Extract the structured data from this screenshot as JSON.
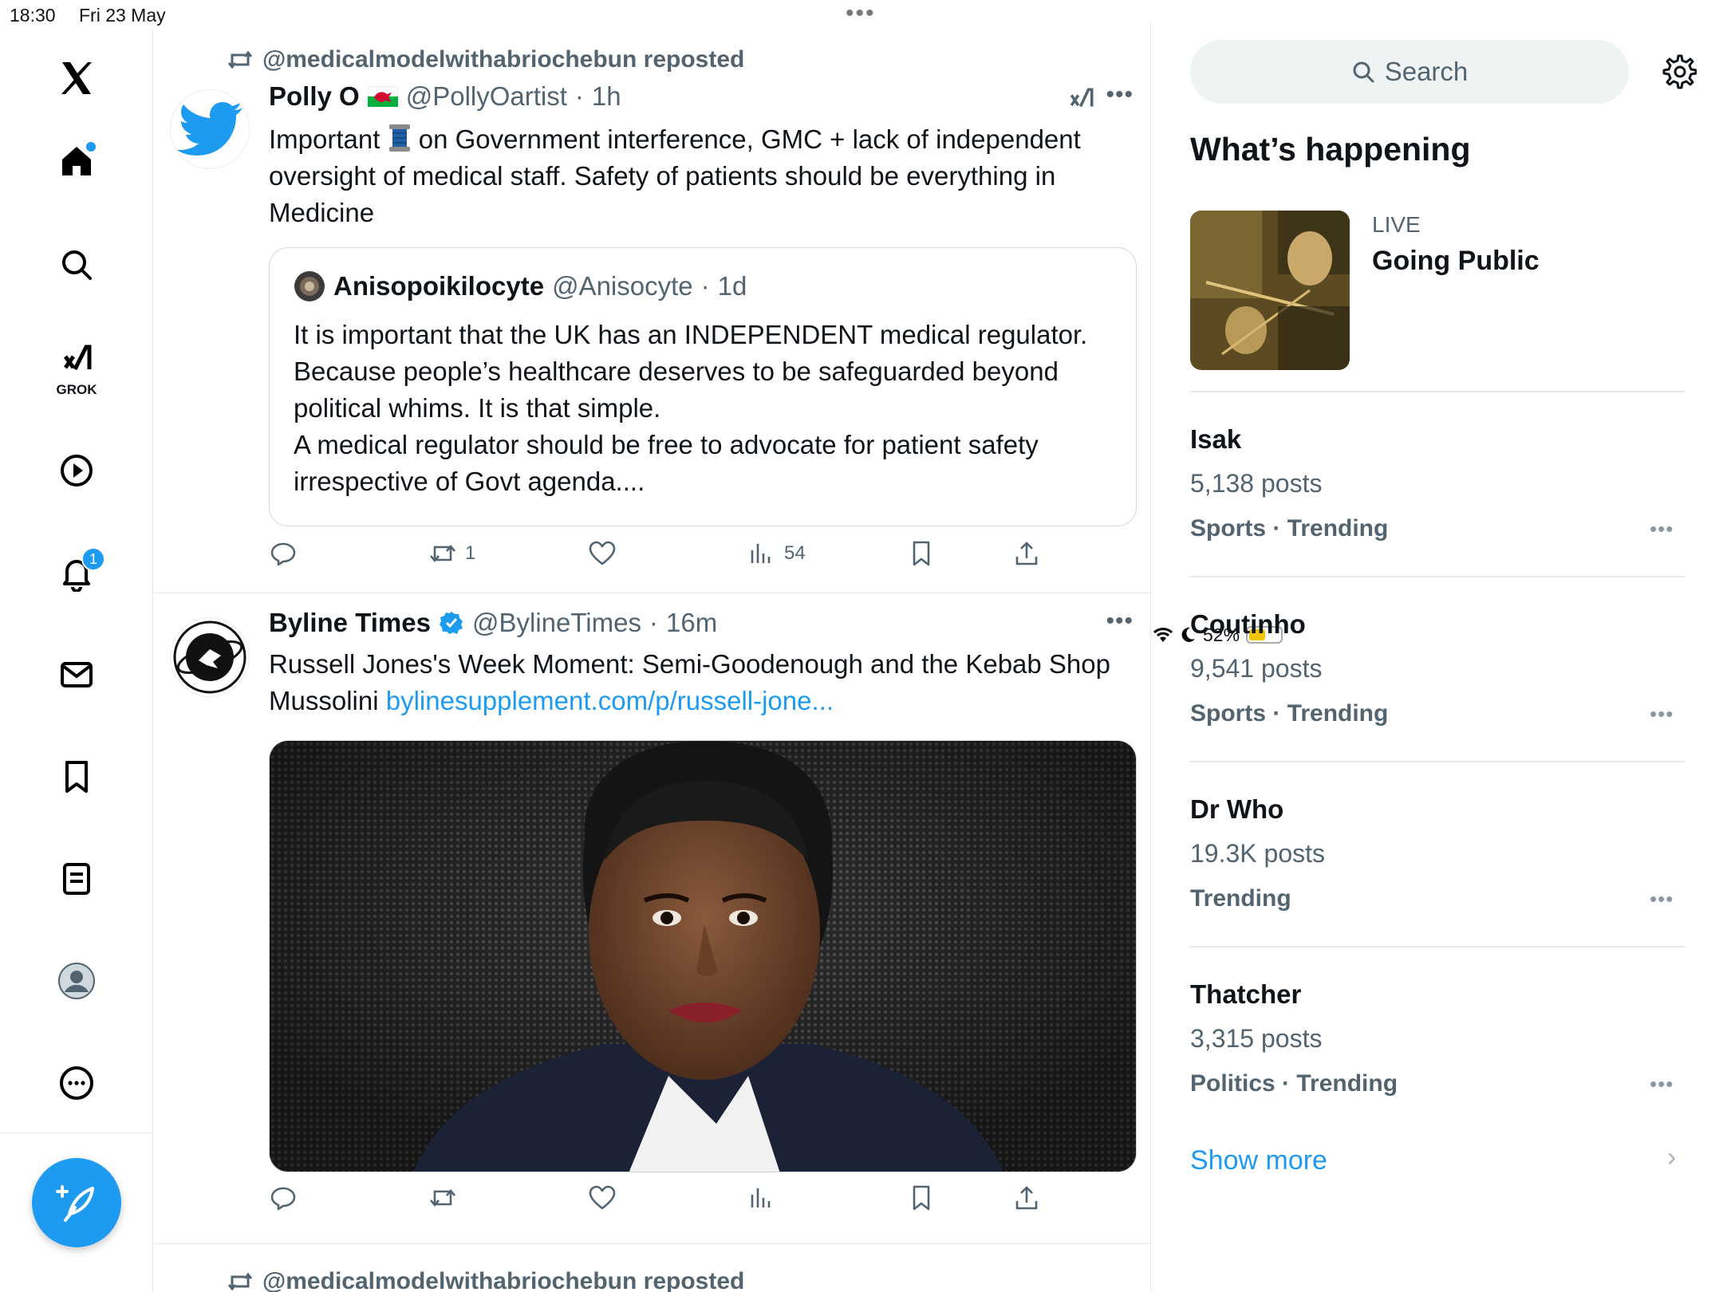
{
  "status_bar": {
    "time": "18:30",
    "date": "Fri 23 May",
    "battery": "52%",
    "battery_level": 0.52
  },
  "nav": {
    "grok_label": "GROK",
    "notifications_badge": "1"
  },
  "feed": {
    "tweets": [
      {
        "repost_text": "@medicalmodelwithabriochebun reposted",
        "name": "Polly O",
        "handle": "@PollyOartist",
        "time": "1h",
        "text_before_emoji": "Important ",
        "text_after_emoji": " on Government interference, GMC + lack of independent oversight of medical staff.   Safety of patients should be everything in Medicine",
        "quote": {
          "name": "Anisopoikilocyte",
          "handle": "@Anisocyte",
          "time": "1d",
          "text": "It is important that the UK has an INDEPENDENT medical regulator. Because people’s healthcare deserves to be safeguarded beyond political whims. It is that simple.\nA medical regulator should be free to advocate for patient safety irrespective of Govt agenda...."
        },
        "actions": {
          "reposts": "1",
          "views": "54"
        }
      },
      {
        "name": "Byline Times",
        "handle": "@BylineTimes",
        "time": "16m",
        "text": "Russell Jones's Week Moment: Semi-Goodenough and the Kebab Shop Mussolini ",
        "link": "bylinesupplement.com/p/russell-jone..."
      },
      {
        "repost_text": "@medicalmodelwithabriochebun reposted"
      }
    ]
  },
  "right": {
    "search_placeholder": "Search",
    "whats_happening": "What’s happening",
    "live": {
      "label": "LIVE",
      "title": "Going Public"
    },
    "trends": [
      {
        "name": "Isak",
        "posts": "5,138 posts",
        "category": "Sports · Trending"
      },
      {
        "name": "Coutinho",
        "posts": "9,541 posts",
        "category": "Sports · Trending"
      },
      {
        "name": "Dr Who",
        "posts": "19.3K posts",
        "category": "Trending"
      },
      {
        "name": "Thatcher",
        "posts": "3,315 posts",
        "category": "Politics · Trending"
      }
    ],
    "show_more": "Show more"
  },
  "colors": {
    "accent": "#1d9bf0",
    "secondary_text": "#536471",
    "border": "#e6e9eb"
  }
}
